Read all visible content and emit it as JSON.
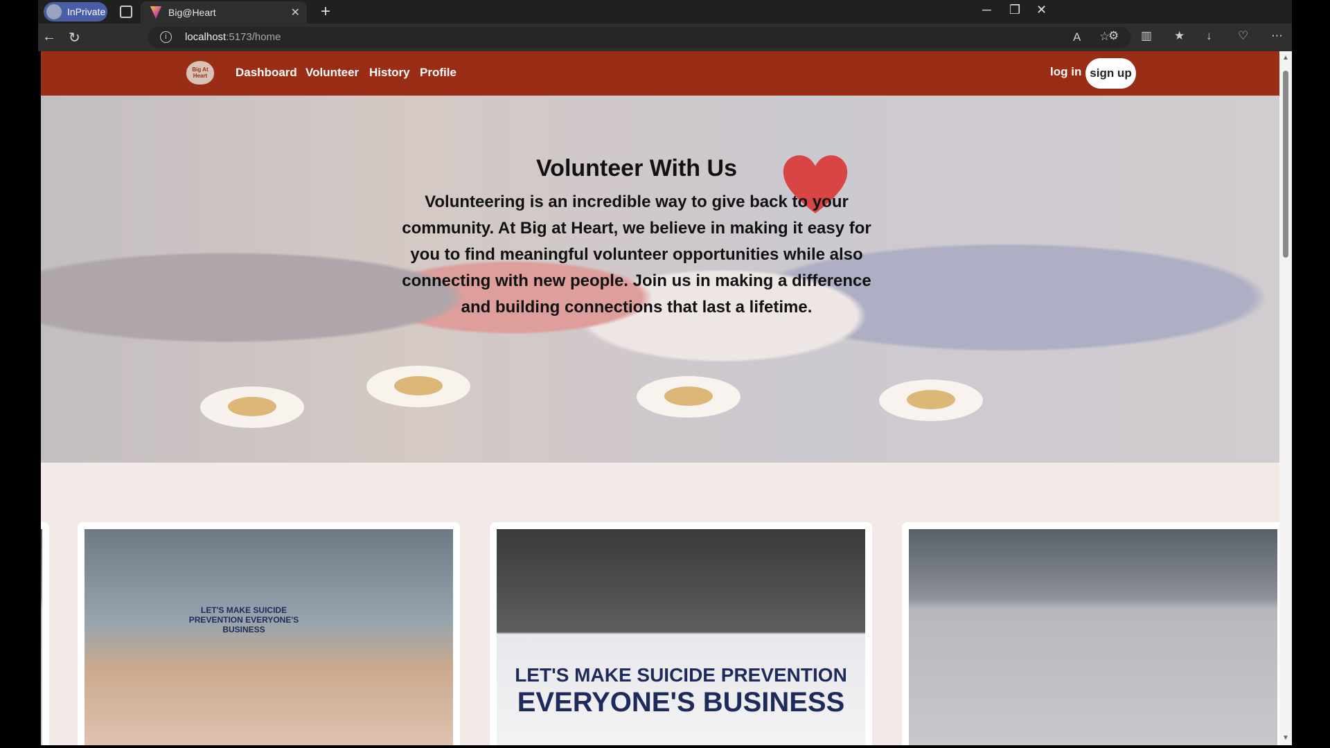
{
  "browser": {
    "profile_label": "InPrivate",
    "tab_title": "Big@Heart",
    "url_host": "localhost",
    "url_path": ":5173/home"
  },
  "navbar": {
    "logo_text": "Big At Heart",
    "links": [
      "Dashboard",
      "Volunteer",
      "History",
      "Profile"
    ],
    "login_label": "log in",
    "signup_label": "sign up",
    "brand_color": "#9a2d16"
  },
  "hero": {
    "title": "Volunteer With Us",
    "body": "Volunteering is an incredible way to give back to your community. At Big at Heart, we believe in making it easy for you to find meaningful volunteer opportunities while also connecting with new people. Join us in making a difference and building connections that last a lifetime."
  },
  "cards": [
    {
      "banner": "LET'S MAKE SUICIDE PREVENTION EVERYONE'S BUSINESS"
    },
    {
      "banner_line1": "LET'S MAKE SUICIDE PREVENTION",
      "banner_line2": "EVERYONE'S BUSINESS"
    },
    {
      "banner": ""
    }
  ]
}
